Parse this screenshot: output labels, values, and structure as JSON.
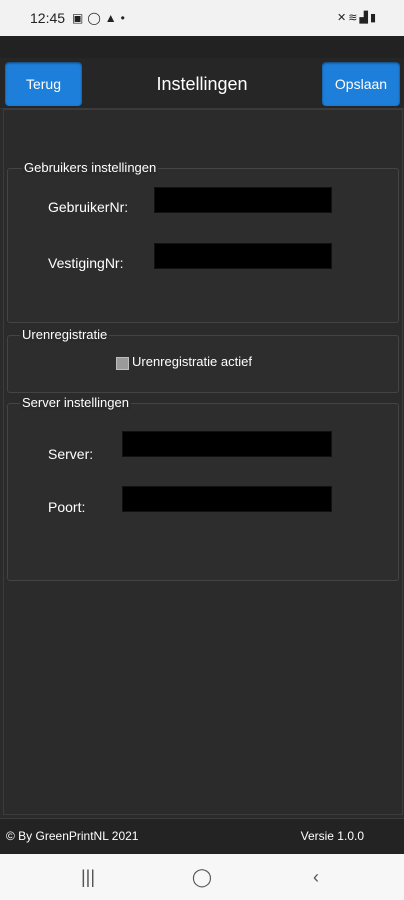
{
  "status_bar": {
    "time": "12:45",
    "left_icons": [
      "image-icon",
      "circle-icon",
      "warning-icon",
      "dot-icon"
    ],
    "right_icons": [
      "mute-icon",
      "wifi-icon",
      "signal-icon",
      "battery-icon"
    ]
  },
  "header": {
    "back_label": "Terug",
    "title": "Instellingen",
    "save_label": "Opslaan",
    "accent_color": "#1d7fd9"
  },
  "user_settings": {
    "legend": "Gebruikers instellingen",
    "user_label": "GebruikerNr:",
    "user_value": "",
    "branch_label": "VestigingNr:",
    "branch_value": ""
  },
  "time_registration": {
    "legend": "Urenregistratie",
    "checkbox_label": "Urenregistratie actief",
    "checked": false
  },
  "server_settings": {
    "legend": "Server instellingen",
    "server_label": "Server:",
    "server_value": "",
    "port_label": "Poort:",
    "port_value": ""
  },
  "footer": {
    "copyright": "© By GreenPrintNL 2021",
    "version": "Versie 1.0.0"
  },
  "navbar": {
    "recent_icon": "recent-apps-icon",
    "home_icon": "home-icon",
    "back_icon": "back-icon"
  }
}
